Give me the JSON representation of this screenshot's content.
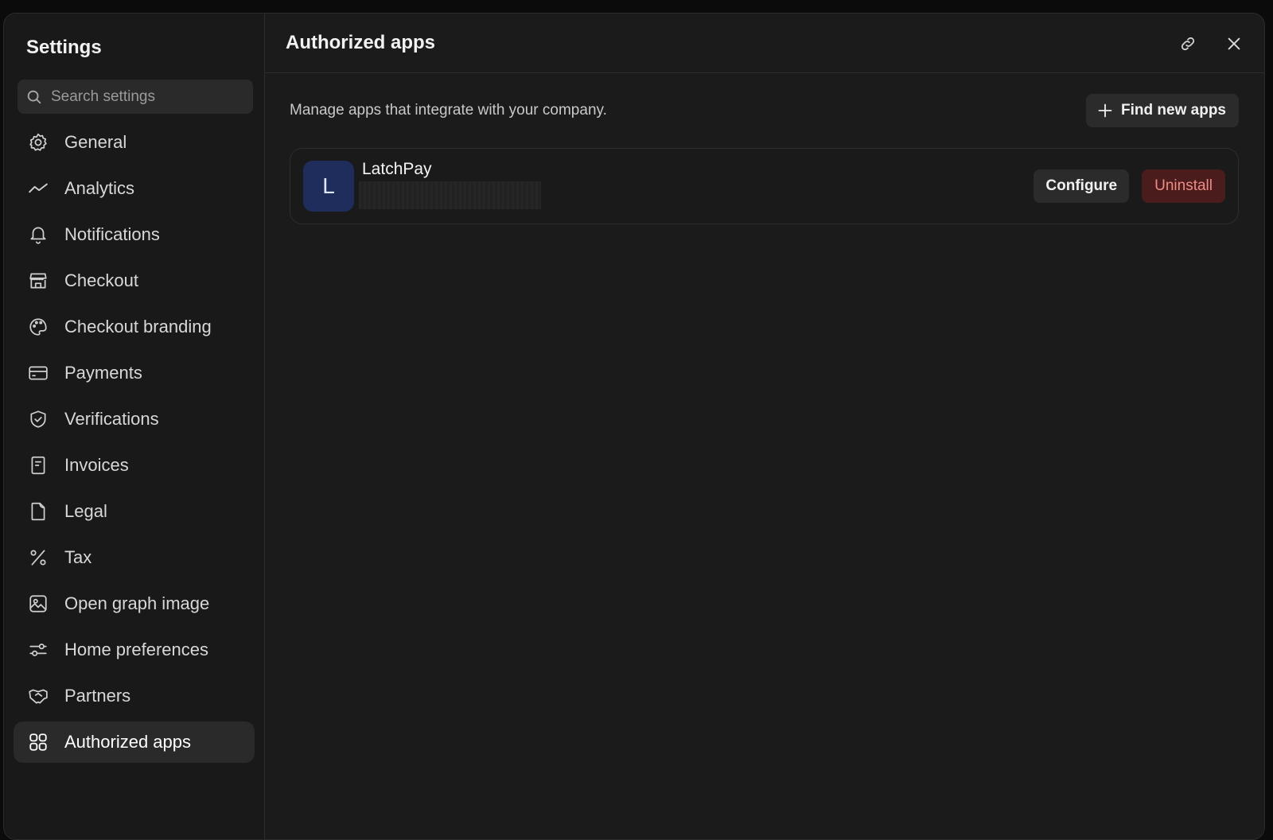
{
  "sidebar": {
    "title": "Settings",
    "search_placeholder": "Search settings",
    "items": [
      {
        "label": "General",
        "icon": "gear-icon"
      },
      {
        "label": "Analytics",
        "icon": "chart-line-icon"
      },
      {
        "label": "Notifications",
        "icon": "bell-icon"
      },
      {
        "label": "Checkout",
        "icon": "storefront-icon"
      },
      {
        "label": "Checkout branding",
        "icon": "palette-icon"
      },
      {
        "label": "Payments",
        "icon": "credit-card-icon"
      },
      {
        "label": "Verifications",
        "icon": "shield-check-icon"
      },
      {
        "label": "Invoices",
        "icon": "receipt-icon"
      },
      {
        "label": "Legal",
        "icon": "document-icon"
      },
      {
        "label": "Tax",
        "icon": "percent-icon"
      },
      {
        "label": "Open graph image",
        "icon": "image-icon"
      },
      {
        "label": "Home preferences",
        "icon": "sliders-icon"
      },
      {
        "label": "Partners",
        "icon": "handshake-icon"
      },
      {
        "label": "Authorized apps",
        "icon": "apps-grid-icon",
        "active": true
      }
    ]
  },
  "main": {
    "title": "Authorized apps",
    "description": "Manage apps that integrate with your company.",
    "find_button_label": "Find new apps",
    "apps": [
      {
        "name": "LatchPay",
        "avatar_letter": "L",
        "avatar_color": "#1e2d5c",
        "configure_label": "Configure",
        "uninstall_label": "Uninstall"
      }
    ]
  },
  "colors": {
    "background": "#1b1b1b",
    "danger_bg": "#4a1c1c",
    "danger_text": "#ee8c84"
  }
}
